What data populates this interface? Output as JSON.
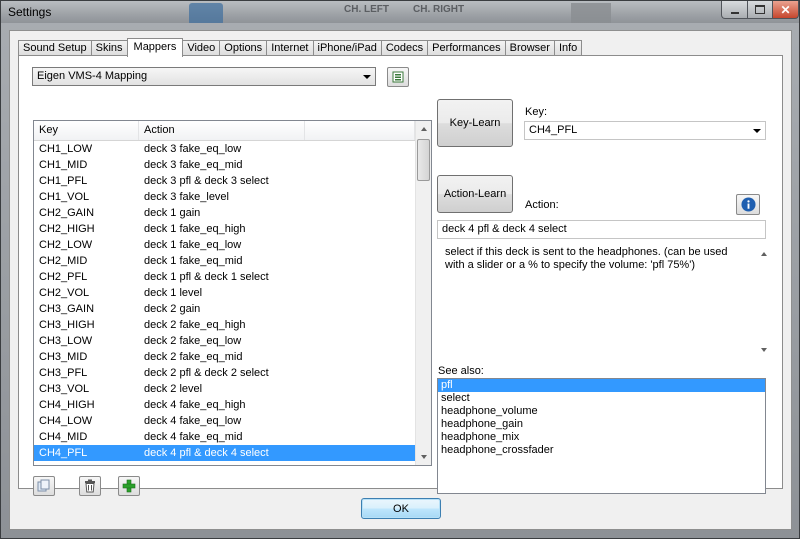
{
  "window": {
    "title": "Settings",
    "background_labels": [
      "CH. LEFT",
      "CH. RIGHT"
    ]
  },
  "tabs": [
    {
      "label": "Sound Setup"
    },
    {
      "label": "Skins"
    },
    {
      "label": "Mappers",
      "active": true
    },
    {
      "label": "Video"
    },
    {
      "label": "Options"
    },
    {
      "label": "Internet"
    },
    {
      "label": "iPhone/iPad"
    },
    {
      "label": "Codecs"
    },
    {
      "label": "Performances"
    },
    {
      "label": "Browser"
    },
    {
      "label": "Info"
    }
  ],
  "mapper": {
    "selected_mapping": "Eigen VMS-4 Mapping",
    "columns": {
      "key": "Key",
      "action": "Action"
    },
    "rows": [
      {
        "key": "CH1_LOW",
        "action": "deck 3 fake_eq_low"
      },
      {
        "key": "CH1_MID",
        "action": "deck 3 fake_eq_mid"
      },
      {
        "key": "CH1_PFL",
        "action": "deck 3 pfl & deck 3 select"
      },
      {
        "key": "CH1_VOL",
        "action": "deck 3 fake_level"
      },
      {
        "key": "CH2_GAIN",
        "action": "deck 1 gain"
      },
      {
        "key": "CH2_HIGH",
        "action": "deck 1 fake_eq_high"
      },
      {
        "key": "CH2_LOW",
        "action": "deck 1 fake_eq_low"
      },
      {
        "key": "CH2_MID",
        "action": "deck 1 fake_eq_mid"
      },
      {
        "key": "CH2_PFL",
        "action": "deck 1 pfl & deck 1 select"
      },
      {
        "key": "CH2_VOL",
        "action": "deck 1 level"
      },
      {
        "key": "CH3_GAIN",
        "action": "deck 2 gain"
      },
      {
        "key": "CH3_HIGH",
        "action": "deck 2 fake_eq_high"
      },
      {
        "key": "CH3_LOW",
        "action": "deck 2 fake_eq_low"
      },
      {
        "key": "CH3_MID",
        "action": "deck 2 fake_eq_mid"
      },
      {
        "key": "CH3_PFL",
        "action": "deck 2 pfl & deck 2 select"
      },
      {
        "key": "CH3_VOL",
        "action": "deck 2 level"
      },
      {
        "key": "CH4_HIGH",
        "action": "deck 4 fake_eq_high"
      },
      {
        "key": "CH4_LOW",
        "action": "deck 4 fake_eq_low"
      },
      {
        "key": "CH4_MID",
        "action": "deck 4 fake_eq_mid"
      },
      {
        "key": "CH4_PFL",
        "action": "deck 4 pfl & deck 4 select",
        "selected": true
      }
    ],
    "bottom_buttons": [
      "copy-icon",
      "trash-icon",
      "add-icon"
    ]
  },
  "detail": {
    "key_learn_label": "Key-Learn",
    "key_label": "Key:",
    "key_value": "CH4_PFL",
    "action_learn_label": "Action-Learn",
    "action_label": "Action:",
    "action_value": "deck 4 pfl & deck 4 select",
    "description": "select if this deck is sent to the headphones. (can be used with a slider or a % to specify the volume: 'pfl 75%')",
    "see_also_label": "See also:",
    "see_also": [
      "pfl",
      "select",
      "headphone_volume",
      "headphone_gain",
      "headphone_mix",
      "headphone_crossfader"
    ]
  },
  "footer": {
    "ok_label": "OK"
  },
  "colors": {
    "selection": "#3399ff",
    "info_icon": "#1f5fb0",
    "add_icon": "#2aa12a"
  }
}
